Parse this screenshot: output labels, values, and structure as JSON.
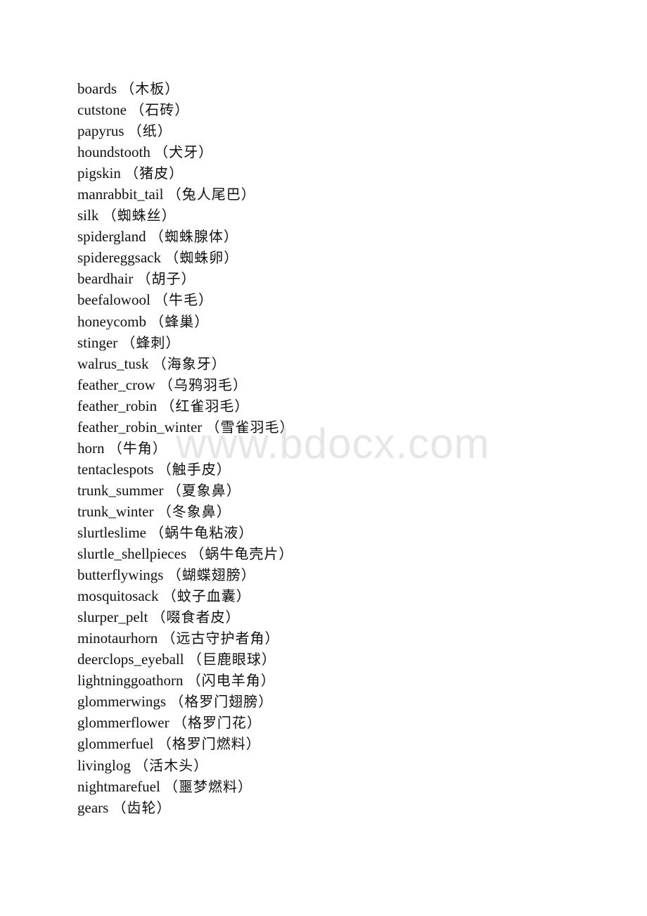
{
  "document": {
    "watermark": "www.bdocx.com",
    "items": [
      {
        "en": "boards",
        "zh": "（木板）"
      },
      {
        "en": "cutstone",
        "zh": "（石砖）"
      },
      {
        "en": "papyrus",
        "zh": "（纸）"
      },
      {
        "en": "houndstooth",
        "zh": "（犬牙）"
      },
      {
        "en": "pigskin",
        "zh": "（猪皮）"
      },
      {
        "en": "manrabbit_tail",
        "zh": "（兔人尾巴）"
      },
      {
        "en": "silk",
        "zh": "（蜘蛛丝）"
      },
      {
        "en": "spidergland",
        "zh": "（蜘蛛腺体）"
      },
      {
        "en": "spidereggsack",
        "zh": "（蜘蛛卵）"
      },
      {
        "en": "beardhair",
        "zh": "（胡子）"
      },
      {
        "en": "beefalowool",
        "zh": "（牛毛）"
      },
      {
        "en": "honeycomb",
        "zh": "（蜂巢）"
      },
      {
        "en": "stinger",
        "zh": "（蜂刺）"
      },
      {
        "en": "walrus_tusk",
        "zh": "（海象牙）"
      },
      {
        "en": "feather_crow",
        "zh": "（乌鸦羽毛）"
      },
      {
        "en": "feather_robin",
        "zh": "（红雀羽毛）"
      },
      {
        "en": "feather_robin_winter",
        "zh": "（雪雀羽毛）"
      },
      {
        "en": "horn",
        "zh": "（牛角）"
      },
      {
        "en": "tentaclespots",
        "zh": "（触手皮）"
      },
      {
        "en": "trunk_summer",
        "zh": "（夏象鼻）"
      },
      {
        "en": "trunk_winter",
        "zh": "（冬象鼻）"
      },
      {
        "en": "slurtleslime",
        "zh": "（蜗牛龟粘液）"
      },
      {
        "en": "slurtle_shellpieces",
        "zh": "（蜗牛龟壳片）"
      },
      {
        "en": "butterflywings",
        "zh": "（蝴蝶翅膀）"
      },
      {
        "en": "mosquitosack",
        "zh": "（蚊子血囊）"
      },
      {
        "en": "slurper_pelt",
        "zh": "（啜食者皮）"
      },
      {
        "en": "minotaurhorn",
        "zh": "（远古守护者角）"
      },
      {
        "en": "deerclops_eyeball",
        "zh": "（巨鹿眼球）"
      },
      {
        "en": "lightninggoathorn",
        "zh": "（闪电羊角）"
      },
      {
        "en": "glommerwings",
        "zh": "（格罗门翅膀）"
      },
      {
        "en": "glommerflower",
        "zh": "（格罗门花）"
      },
      {
        "en": "glommerfuel",
        "zh": "（格罗门燃料）"
      },
      {
        "en": "livinglog",
        "zh": "（活木头）"
      },
      {
        "en": "nightmarefuel",
        "zh": "（噩梦燃料）"
      },
      {
        "en": "gears",
        "zh": "（齿轮）"
      }
    ]
  }
}
